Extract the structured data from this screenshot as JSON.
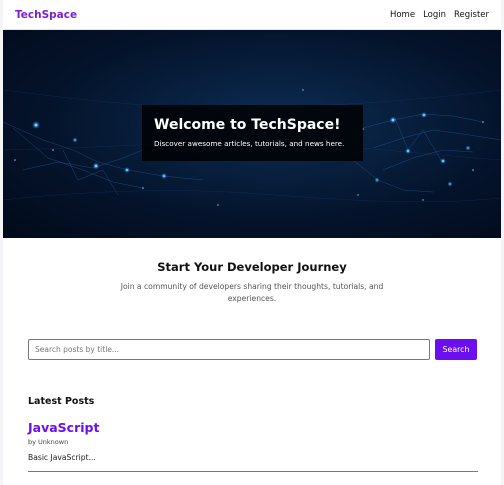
{
  "navbar": {
    "brand": "TechSpace",
    "links": [
      "Home",
      "Login",
      "Register"
    ]
  },
  "hero": {
    "title": "Welcome to TechSpace!",
    "subtitle": "Discover awesome articles, tutorials, and news here."
  },
  "intro": {
    "title": "Start Your Developer Journey",
    "text": "Join a community of developers sharing their thoughts, tutorials, and experiences."
  },
  "search": {
    "placeholder": "Search posts by title...",
    "button_label": "Search"
  },
  "posts": {
    "heading": "Latest Posts",
    "items": [
      {
        "title": "JavaScript",
        "author": "by Unknown",
        "excerpt": "Basic JavaScript..."
      }
    ]
  },
  "colors": {
    "brand": "#7b1fd6",
    "accent": "#6b0ff0",
    "hero_bg": "#04132b"
  }
}
